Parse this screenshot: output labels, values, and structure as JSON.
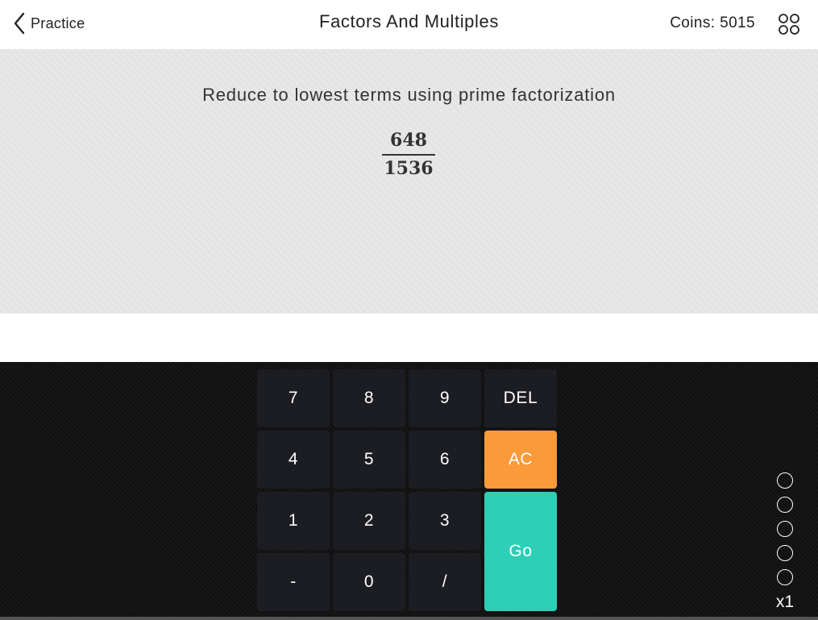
{
  "header": {
    "back_label": "Practice",
    "title": "Factors And Multiples",
    "coins_text": "Coins: 5015",
    "back_icon": "chevron-left-icon",
    "menu_icon": "grid-dots-icon"
  },
  "question": {
    "prompt": "Reduce to lowest terms using prime factorization",
    "numerator": "648",
    "denominator": "1536"
  },
  "keypad": {
    "keys": [
      "7",
      "8",
      "9",
      "DEL",
      "4",
      "5",
      "6",
      "AC",
      "1",
      "2",
      "3",
      "Go",
      "-",
      "0",
      "/"
    ]
  },
  "progress": {
    "total": 5,
    "completed": 0,
    "multiplier": "x1"
  },
  "colors": {
    "ac_key": "#fb9a3b",
    "go_key": "#2dcfb6",
    "key": "#1c1d22",
    "keypad_bg": "#111111",
    "question_bg": "#e4e4e4"
  }
}
